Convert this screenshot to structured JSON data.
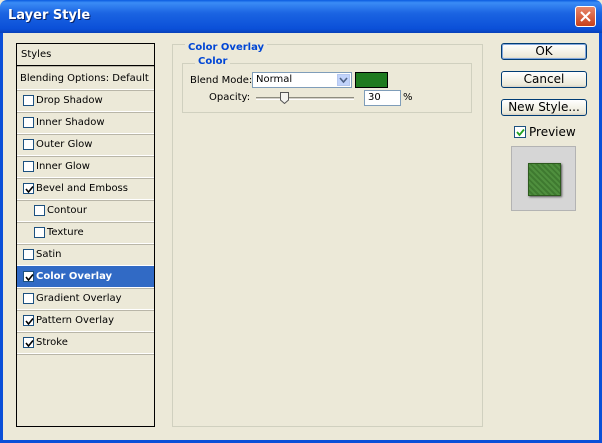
{
  "window": {
    "title": "Layer Style"
  },
  "styles_list": {
    "header": "Styles",
    "blending": "Blending Options: Default",
    "items": [
      {
        "label": "Drop Shadow",
        "checked": false,
        "indent": false,
        "selected": false
      },
      {
        "label": "Inner Shadow",
        "checked": false,
        "indent": false,
        "selected": false
      },
      {
        "label": "Outer Glow",
        "checked": false,
        "indent": false,
        "selected": false
      },
      {
        "label": "Inner Glow",
        "checked": false,
        "indent": false,
        "selected": false
      },
      {
        "label": "Bevel and Emboss",
        "checked": true,
        "indent": false,
        "selected": false
      },
      {
        "label": "Contour",
        "checked": false,
        "indent": true,
        "selected": false
      },
      {
        "label": "Texture",
        "checked": false,
        "indent": true,
        "selected": false
      },
      {
        "label": "Satin",
        "checked": false,
        "indent": false,
        "selected": false
      },
      {
        "label": "Color Overlay",
        "checked": true,
        "indent": false,
        "selected": true
      },
      {
        "label": "Gradient Overlay",
        "checked": false,
        "indent": false,
        "selected": false
      },
      {
        "label": "Pattern Overlay",
        "checked": true,
        "indent": false,
        "selected": false
      },
      {
        "label": "Stroke",
        "checked": true,
        "indent": false,
        "selected": false
      }
    ]
  },
  "panel": {
    "group_title": "Color Overlay",
    "sub_title": "Color",
    "blend_mode_label": "Blend Mode:",
    "blend_mode_value": "Normal",
    "overlay_color": "#1e7a1e",
    "opacity_label": "Opacity:",
    "opacity_value": "30",
    "opacity_unit": "%"
  },
  "buttons": {
    "ok": "OK",
    "cancel": "Cancel",
    "new_style": "New Style..."
  },
  "preview": {
    "label": "Preview",
    "checked": true
  }
}
